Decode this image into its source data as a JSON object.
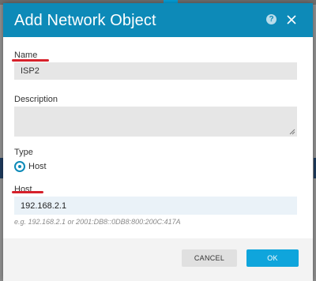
{
  "dialog": {
    "title": "Add Network Object",
    "help_icon": "help-icon",
    "close_icon": "close-icon"
  },
  "form": {
    "name": {
      "label": "Name",
      "value": "ISP2"
    },
    "description": {
      "label": "Description",
      "value": ""
    },
    "type": {
      "label": "Type",
      "option": "Host",
      "selected": true
    },
    "host": {
      "label": "Host",
      "value": "192.168.2.1",
      "hint": "e.g. 192.168.2.1 or 2001:DB8::0DB8:800:200C:417A"
    }
  },
  "buttons": {
    "cancel": "CANCEL",
    "ok": "OK"
  },
  "colors": {
    "header": "#0d8ab8",
    "accent": "#0fa5dc",
    "annotation": "#d6212b"
  }
}
